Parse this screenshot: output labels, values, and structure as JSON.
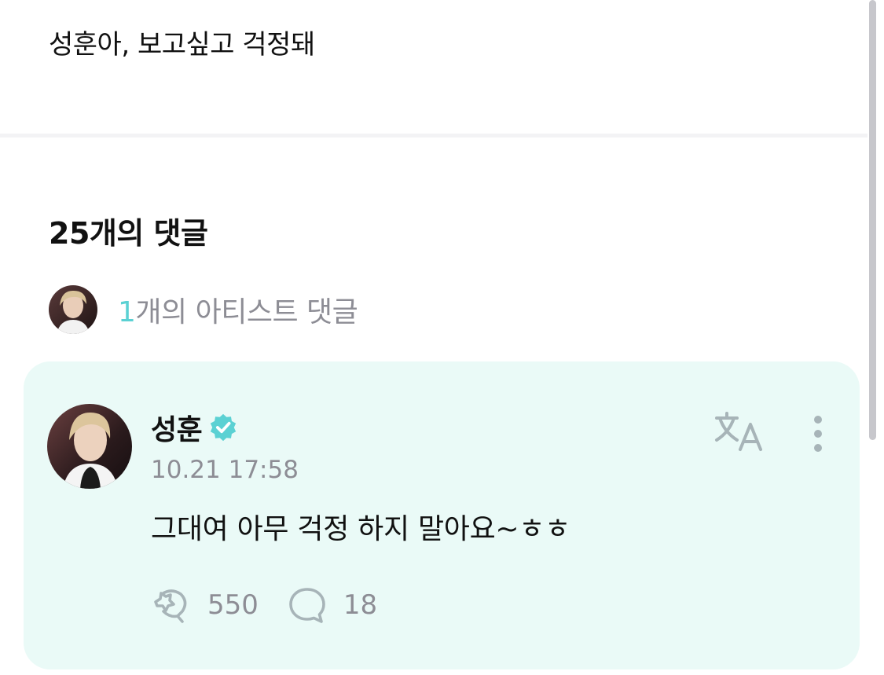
{
  "post": {
    "text": "성훈아, 보고싶고 걱정돼"
  },
  "comments": {
    "heading": "25개의 댓글",
    "artist_summary": {
      "count": "1",
      "suffix": "개의 아티스트 댓글"
    }
  },
  "artist_comment": {
    "author": "성훈",
    "timestamp": "10.21 17:58",
    "body": "그대여 아무 걱정 하지 말아요~ㅎㅎ",
    "like_count": "550",
    "reply_count": "18"
  },
  "icons": {
    "verified": "verified-badge-icon",
    "translate": "translate-icon",
    "more": "more-vertical-icon",
    "like": "heart-cheer-icon",
    "reply": "speech-bubble-icon"
  },
  "colors": {
    "accent": "#5bd1d3",
    "card_background": "#eafaf7",
    "muted_text": "#8d8d95"
  }
}
